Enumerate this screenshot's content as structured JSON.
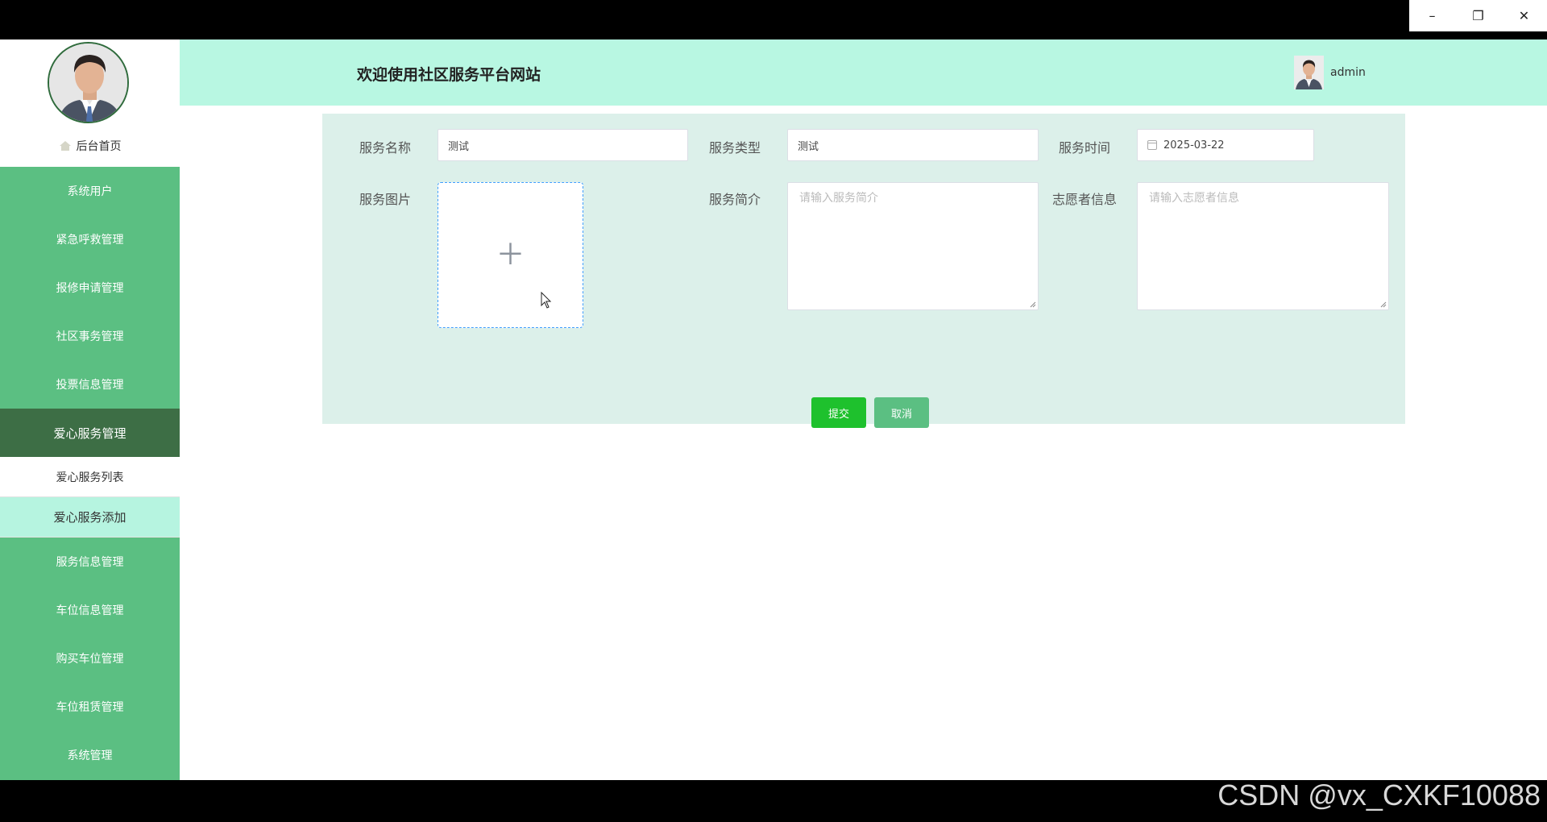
{
  "window": {
    "minimize_label": "–",
    "restore_label": "❐",
    "close_label": "✕"
  },
  "header": {
    "title": "欢迎使用社区服务平台网站",
    "username": "admin"
  },
  "sidebar": {
    "home_label": "后台首页",
    "items": [
      {
        "label": "系统用户"
      },
      {
        "label": "紧急呼救管理"
      },
      {
        "label": "报修申请管理"
      },
      {
        "label": "社区事务管理"
      },
      {
        "label": "投票信息管理"
      },
      {
        "label": "爱心服务管理"
      }
    ],
    "sub_items": [
      {
        "label": "爱心服务列表"
      },
      {
        "label": "爱心服务添加"
      }
    ],
    "items_after": [
      {
        "label": "服务信息管理"
      },
      {
        "label": "车位信息管理"
      },
      {
        "label": "购买车位管理"
      },
      {
        "label": "车位租赁管理"
      },
      {
        "label": "系统管理"
      }
    ]
  },
  "form": {
    "service_name_label": "服务名称",
    "service_name_value": "测试",
    "service_type_label": "服务类型",
    "service_type_value": "测试",
    "service_time_label": "服务时间",
    "service_time_value": "2025-03-22",
    "service_image_label": "服务图片",
    "service_intro_label": "服务简介",
    "service_intro_placeholder": "请输入服务简介",
    "volunteer_label": "志愿者信息",
    "volunteer_placeholder": "请输入志愿者信息",
    "submit_label": "提交",
    "cancel_label": "取消"
  },
  "watermark": "CSDN @vx_CXKF10088"
}
